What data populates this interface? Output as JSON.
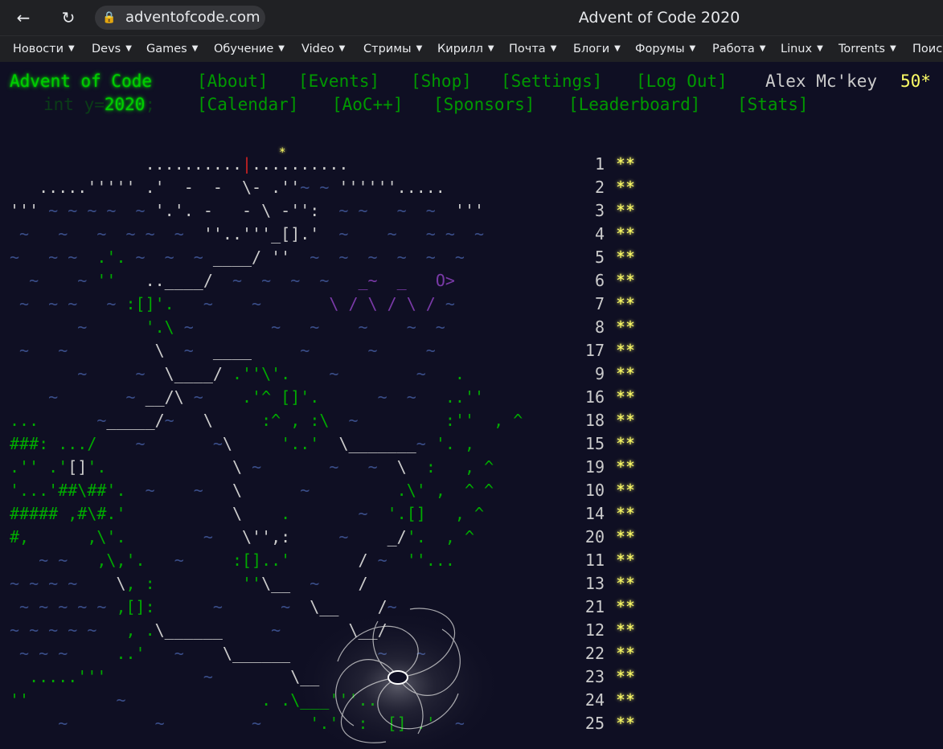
{
  "browser": {
    "back_icon": "arrow-left-icon",
    "reload_icon": "reload-icon",
    "site_info_icon": "lock-icon",
    "url": "adventofcode.com",
    "window_title": "Advent of Code 2020"
  },
  "bookmarks": [
    {
      "label": "Новости"
    },
    {
      "label": "Devs"
    },
    {
      "label": "Games"
    },
    {
      "label": "Обучение"
    },
    {
      "label": "Video"
    },
    {
      "label": "Стримы"
    },
    {
      "label": "Кирилл"
    },
    {
      "label": "Почта"
    },
    {
      "label": "Блоги"
    },
    {
      "label": "Форумы"
    },
    {
      "label": "Работа"
    },
    {
      "label": "Linux"
    },
    {
      "label": "Torrents"
    },
    {
      "label": "Поиск"
    }
  ],
  "header": {
    "title": "Advent of Code",
    "year_prefix": "int y=",
    "year": "2020",
    "year_suffix": ";",
    "nav_top": [
      "[About]",
      "[Events]",
      "[Shop]",
      "[Settings]",
      "[Log Out]"
    ],
    "nav_bottom": [
      "[Calendar]",
      "[AoC++]",
      "[Sponsors]",
      "[Leaderboard]",
      "[Stats]"
    ],
    "user": "Alex Mc'key",
    "stars": "50*"
  },
  "calendar": {
    "rows": [
      {
        "day": "1",
        "stars": "**"
      },
      {
        "day": "2",
        "stars": "**"
      },
      {
        "day": "3",
        "stars": "**"
      },
      {
        "day": "4",
        "stars": "**"
      },
      {
        "day": "5",
        "stars": "**"
      },
      {
        "day": "6",
        "stars": "**"
      },
      {
        "day": "7",
        "stars": "**"
      },
      {
        "day": "8",
        "stars": "**"
      },
      {
        "day": "17",
        "stars": "**"
      },
      {
        "day": "9",
        "stars": "**"
      },
      {
        "day": "16",
        "stars": "**"
      },
      {
        "day": "18",
        "stars": "**"
      },
      {
        "day": "15",
        "stars": "**"
      },
      {
        "day": "19",
        "stars": "**"
      },
      {
        "day": "10",
        "stars": "**"
      },
      {
        "day": "14",
        "stars": "**"
      },
      {
        "day": "20",
        "stars": "**"
      },
      {
        "day": "11",
        "stars": "**"
      },
      {
        "day": "13",
        "stars": "**"
      },
      {
        "day": "21",
        "stars": "**"
      },
      {
        "day": "12",
        "stars": "**"
      },
      {
        "day": "22",
        "stars": "**"
      },
      {
        "day": "23",
        "stars": "**"
      },
      {
        "day": "24",
        "stars": "**"
      },
      {
        "day": "25",
        "stars": "**"
      }
    ]
  },
  "colors": {
    "background": "#0f0f23",
    "title_green": "#00cc00",
    "link_green": "#009900",
    "star_yellow": "#ffff66",
    "wave_blue": "#3a4e8a",
    "sea_monster_purple": "#7a3aa8"
  }
}
